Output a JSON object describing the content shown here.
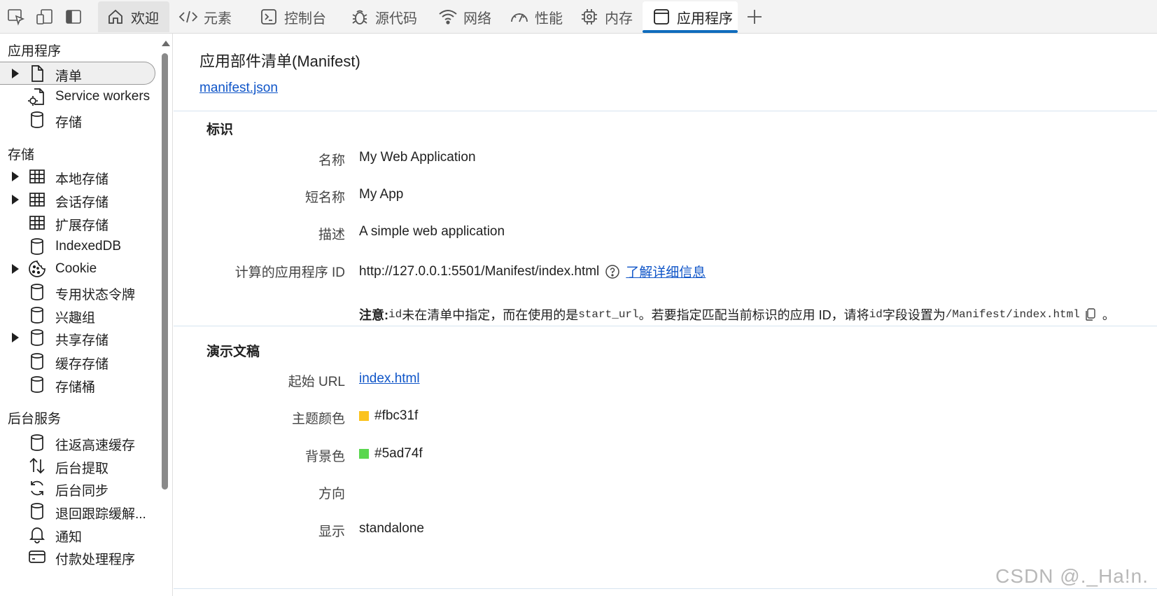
{
  "toolbar": {
    "tabs": [
      {
        "label": "欢迎"
      },
      {
        "label": "元素"
      },
      {
        "label": "控制台"
      },
      {
        "label": "源代码"
      },
      {
        "label": "网络"
      },
      {
        "label": "性能"
      },
      {
        "label": "内存"
      },
      {
        "label": "应用程序"
      }
    ]
  },
  "sidebar": {
    "app_heading": "应用程序",
    "app_items": [
      {
        "label": "清单"
      },
      {
        "label": "Service workers"
      },
      {
        "label": "存储"
      }
    ],
    "storage_heading": "存储",
    "storage_items": [
      {
        "label": "本地存储"
      },
      {
        "label": "会话存储"
      },
      {
        "label": "扩展存储"
      },
      {
        "label": "IndexedDB"
      },
      {
        "label": "Cookie"
      },
      {
        "label": "专用状态令牌"
      },
      {
        "label": "兴趣组"
      },
      {
        "label": "共享存储"
      },
      {
        "label": "缓存存储"
      },
      {
        "label": "存储桶"
      }
    ],
    "bg_heading": "后台服务",
    "bg_items": [
      {
        "label": "往返高速缓存"
      },
      {
        "label": "后台提取"
      },
      {
        "label": "后台同步"
      },
      {
        "label": "退回跟踪缓解..."
      },
      {
        "label": "通知"
      },
      {
        "label": "付款处理程序"
      }
    ]
  },
  "main": {
    "title": "应用部件清单(Manifest)",
    "manifest_link": "manifest.json",
    "identity": {
      "title": "标识",
      "name_label": "名称",
      "name_value": "My Web Application",
      "short_name_label": "短名称",
      "short_name_value": "My App",
      "desc_label": "描述",
      "desc_value": "A simple web application",
      "id_label": "计算的应用程序 ID",
      "id_value": "http://127.0.0.1:5501/Manifest/index.html",
      "learn_more": "了解详细信息",
      "note_bold": "注意:",
      "note_code1": "id",
      "note_text1": " 未在清单中指定，而在使用的是",
      "note_code2": "start_url",
      "note_text2": "。若要指定匹配当前标识的应用 ID，请将 ",
      "note_code3": "id",
      "note_text3": " 字段设置为",
      "note_code4": "/Manifest/index.html",
      "note_text4": "。"
    },
    "presentation": {
      "title": "演示文稿",
      "start_url_label": "起始 URL",
      "start_url_value": "index.html",
      "theme_label": "主题颜色",
      "theme_value": "#fbc31f",
      "bg_label": "背景色",
      "bg_value": "#5ad74f",
      "orientation_label": "方向",
      "orientation_value": "",
      "display_label": "显示",
      "display_value": "standalone"
    }
  },
  "colors": {
    "theme_swatch": "#fbc31f",
    "bg_swatch": "#5ad74f",
    "link": "#0f55c8",
    "active_tab_indicator": "#0f6cbd"
  },
  "watermark": "CSDN @._Ha!n."
}
